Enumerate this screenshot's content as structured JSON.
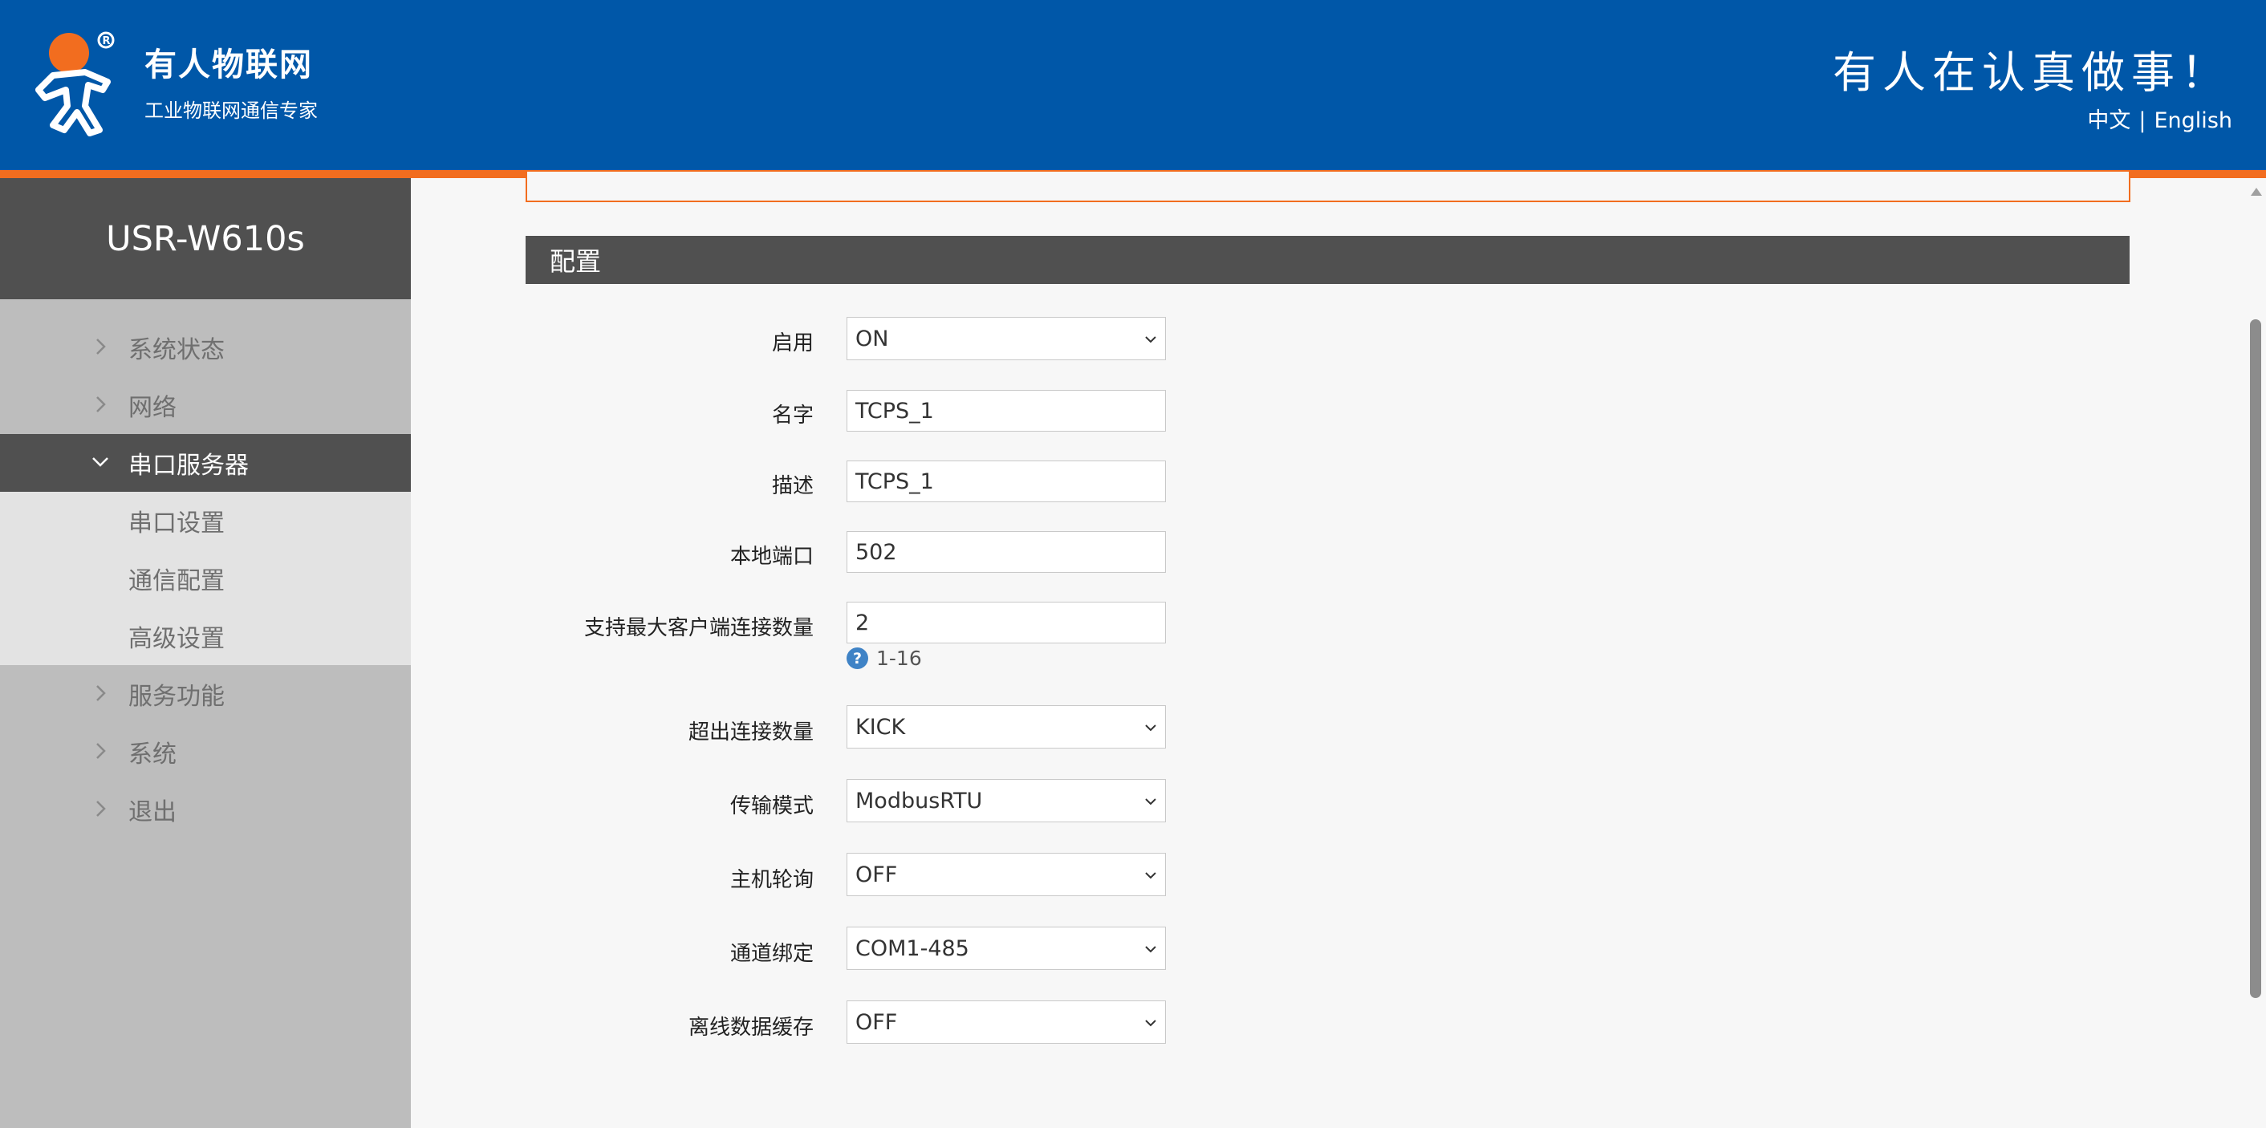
{
  "header": {
    "brand_name": "有人物联网",
    "brand_sub": "工业物联网通信专家",
    "slogan": "有人在认真做事！",
    "lang_zh": "中文",
    "lang_sep": "|",
    "lang_en": "English",
    "accent_color": "#0057a8",
    "stripe_color": "#f26d1f"
  },
  "sidebar": {
    "device_name": "USR-W610s",
    "items": [
      {
        "label": "系统状态",
        "icon": "chevron-right-icon"
      },
      {
        "label": "网络",
        "icon": "chevron-right-icon"
      },
      {
        "label": "串口服务器",
        "icon": "chevron-down-icon",
        "active": true
      },
      {
        "label": "服务功能",
        "icon": "chevron-right-icon"
      },
      {
        "label": "系统",
        "icon": "chevron-right-icon"
      },
      {
        "label": "退出",
        "icon": "chevron-right-icon"
      }
    ],
    "subitems": [
      {
        "label": "串口设置"
      },
      {
        "label": "通信配置"
      },
      {
        "label": "高级设置"
      }
    ]
  },
  "main": {
    "section_title": "配置",
    "fields": [
      {
        "label": "启用",
        "value": "ON",
        "type": "select"
      },
      {
        "label": "名字",
        "value": "TCPS_1",
        "type": "text"
      },
      {
        "label": "描述",
        "value": "TCPS_1",
        "type": "text"
      },
      {
        "label": "本地端口",
        "value": "502",
        "type": "text"
      },
      {
        "label": "支持最大客户端连接数量",
        "value": "2",
        "type": "text"
      },
      {
        "label": "超出连接数量",
        "value": "KICK",
        "type": "select"
      },
      {
        "label": "传输模式",
        "value": "ModbusRTU",
        "type": "select"
      },
      {
        "label": "主机轮询",
        "value": "OFF",
        "type": "select"
      },
      {
        "label": "通道绑定",
        "value": "COM1-485",
        "type": "select"
      },
      {
        "label": "离线数据缓存",
        "value": "OFF",
        "type": "select"
      }
    ],
    "max_clients_hint_icon": "help-icon",
    "max_clients_hint": "1-16"
  }
}
